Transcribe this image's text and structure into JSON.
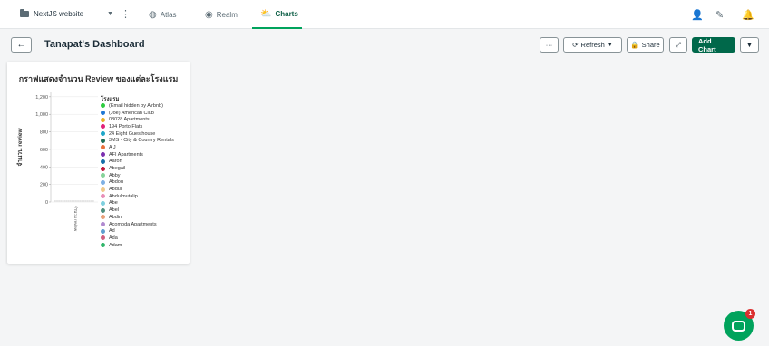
{
  "topbar": {
    "project_name": "NextJS website",
    "tabs": [
      {
        "label": "Atlas",
        "icon": "atlas-icon"
      },
      {
        "label": "Realm",
        "icon": "realm-icon"
      },
      {
        "label": "Charts",
        "icon": "charts-icon",
        "active": true
      }
    ],
    "right_icons": [
      "user-icon",
      "user-edit-icon",
      "bell-icon"
    ]
  },
  "dashboard": {
    "title": "Tanapat's Dashboard",
    "buttons": {
      "more": "···",
      "refresh": "Refresh",
      "share": "Share",
      "add_chart": "Add Chart"
    }
  },
  "card": {
    "title": "กราฟแสดงจำนวน Review ของแต่ละโรงแรม"
  },
  "chart_data": {
    "type": "bar",
    "title": "กราฟแสดงจำนวน Review ของแต่ละโรงแรม",
    "xlabel": "",
    "ylabel": "จำนวน review",
    "categories": [
      "จำนวน review"
    ],
    "ylim": [
      0,
      1250
    ],
    "yticks": [
      0,
      200,
      400,
      600,
      800,
      1000,
      1200
    ],
    "ytick_labels": [
      "0",
      "200",
      "400",
      "600",
      "800",
      "1,000",
      "1,200"
    ],
    "grid": true,
    "legend_position": "right",
    "legend_title": "โรงแรม",
    "series": [
      {
        "name": "(Email hidden by Airbnb)",
        "color": "#2ecc40"
      },
      {
        "name": "(Joe) American Club",
        "color": "#1f77d4"
      },
      {
        "name": "08028 Apartments",
        "color": "#e8b027"
      },
      {
        "name": "194 Porto Flats",
        "color": "#e0237a"
      },
      {
        "name": "24 Eight Guesthouse",
        "color": "#1fa7c9"
      },
      {
        "name": "3MS - City & Country Rentals",
        "color": "#1f6e57"
      },
      {
        "name": "A J",
        "color": "#e8703a"
      },
      {
        "name": "AFI Apartments",
        "color": "#7b2fb0"
      },
      {
        "name": "Aaron",
        "color": "#166fa8"
      },
      {
        "name": "Abegail",
        "color": "#c0173a"
      },
      {
        "name": "Abby",
        "color": "#86d39a"
      },
      {
        "name": "Abdou",
        "color": "#7fb0e3"
      },
      {
        "name": "Abdul",
        "color": "#f0c98a"
      },
      {
        "name": "Abdulmutalip",
        "color": "#e88fb8"
      },
      {
        "name": "Abe",
        "color": "#7fd0df"
      },
      {
        "name": "Abel",
        "color": "#4f8f7e"
      },
      {
        "name": "Abdin",
        "color": "#e8a07a"
      },
      {
        "name": "Acomoda Apartments",
        "color": "#b08ad0"
      },
      {
        "name": "Ad",
        "color": "#5f9fcf"
      },
      {
        "name": "Ada",
        "color": "#d06080"
      },
      {
        "name": "Adam",
        "color": "#2fb56a"
      }
    ]
  }
}
